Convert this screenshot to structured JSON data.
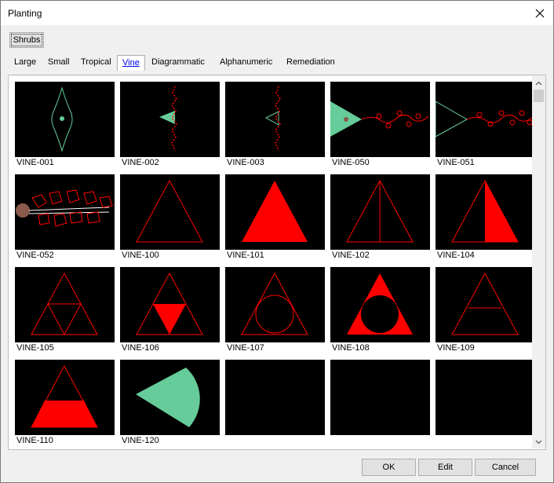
{
  "window": {
    "title": "Planting"
  },
  "category": {
    "label": "Shrubs"
  },
  "tabs": [
    {
      "label": "Large",
      "active": false
    },
    {
      "label": "Small",
      "active": false
    },
    {
      "label": "Tropical",
      "active": false
    },
    {
      "label": "Vine",
      "active": true
    },
    {
      "label": "Diagrammatic",
      "active": false
    },
    {
      "label": "Alphanumeric",
      "active": false
    },
    {
      "label": "Remediation",
      "active": false
    }
  ],
  "items": [
    {
      "label": "VINE-001",
      "symbol": "vine-outline-green"
    },
    {
      "label": "VINE-002",
      "symbol": "vine-red-green-arrow"
    },
    {
      "label": "VINE-003",
      "symbol": "vine-red-outline-arrow"
    },
    {
      "label": "VINE-050",
      "symbol": "vine-horizontal-green-fan"
    },
    {
      "label": "VINE-051",
      "symbol": "vine-horizontal-outline-fan"
    },
    {
      "label": "VINE-052",
      "symbol": "vine-leafy-trunk"
    },
    {
      "label": "VINE-100",
      "symbol": "triangle-outline"
    },
    {
      "label": "VINE-101",
      "symbol": "triangle-filled"
    },
    {
      "label": "VINE-102",
      "symbol": "triangle-split"
    },
    {
      "label": "VINE-104",
      "symbol": "triangle-half-filled"
    },
    {
      "label": "VINE-105",
      "symbol": "triangle-subdivided"
    },
    {
      "label": "VINE-106",
      "symbol": "triangle-inverted-fill"
    },
    {
      "label": "VINE-107",
      "symbol": "triangle-circle"
    },
    {
      "label": "VINE-108",
      "symbol": "triangle-circle-filled"
    },
    {
      "label": "VINE-109",
      "symbol": "triangle-band"
    },
    {
      "label": "VINE-110",
      "symbol": "triangle-bottom-filled"
    },
    {
      "label": "VINE-120",
      "symbol": "fan-sector-green"
    },
    {
      "label": "",
      "symbol": "empty"
    },
    {
      "label": "",
      "symbol": "empty"
    },
    {
      "label": "",
      "symbol": "empty"
    }
  ],
  "buttons": {
    "ok": "OK",
    "edit": "Edit",
    "cancel": "Cancel"
  },
  "colors": {
    "symbol_red": "#ff0000",
    "symbol_green": "#66cc99",
    "tile_bg": "#000000",
    "trunk_brown": "#8b5a4a"
  }
}
